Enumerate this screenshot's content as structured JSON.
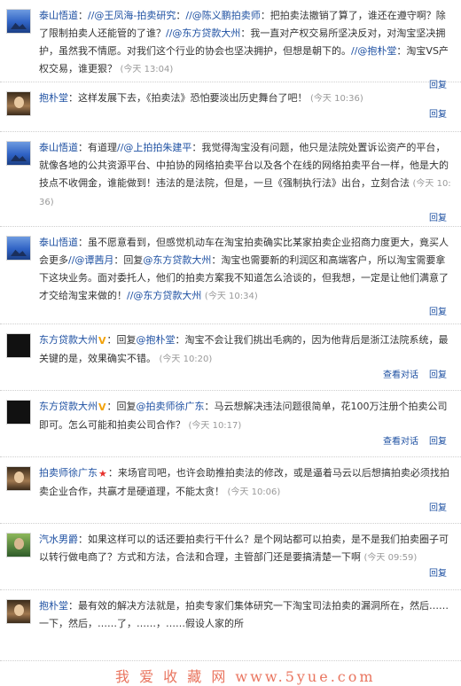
{
  "posts": [
    {
      "avatar": "mountain-sky-avatar",
      "author": "泰山悟道",
      "segments": [
        {
          "t": "text",
          "v": "："
        },
        {
          "t": "link",
          "v": "//@王凤海-拍卖研究"
        },
        {
          "t": "text",
          "v": "："
        },
        {
          "t": "link",
          "v": "//@陈义鹏拍卖师"
        },
        {
          "t": "text",
          "v": "：把拍卖法撤销了算了，谁还在遵守啊？除了限制拍卖人还能管的了谁？"
        },
        {
          "t": "link",
          "v": "//@东方贷款大州"
        },
        {
          "t": "text",
          "v": "：我一直对产权交易所坚决反对，对淘宝坚决拥护，虽然我不情愿。对我们这个行业的协会也坚决拥护，但想是朝下的。"
        },
        {
          "t": "link",
          "v": "//@抱朴堂"
        },
        {
          "t": "text",
          "v": "：淘宝VS产权交易，谁更狠？"
        }
      ],
      "time": "(今天 13:04)",
      "actions": [
        "回复"
      ]
    },
    {
      "avatar": "person-avatar",
      "author": "抱朴堂",
      "segments": [
        {
          "t": "text",
          "v": "：这样发展下去，《拍卖法》恐怕要淡出历史舞台了吧！"
        }
      ],
      "time": "(今天 10:36)",
      "actions": [
        "回复"
      ]
    },
    {
      "avatar": "mountain-sky-avatar",
      "author": "泰山悟道",
      "segments": [
        {
          "t": "text",
          "v": "：有道理"
        },
        {
          "t": "link",
          "v": "//@上拍拍朱建平"
        },
        {
          "t": "text",
          "v": "：我觉得淘宝没有问题，他只是法院处置诉讼资产的平台，就像各地的公共资源平台、中拍协的网络拍卖平台以及各个在线的网络拍卖平台一样，他是大的技点不收佣金，谁能做到！违法的是法院，但是，一旦《强制执行法》出台，立刻合法"
        }
      ],
      "time": "(今天 10:36)",
      "actions": [
        "回复"
      ]
    },
    {
      "avatar": "mountain-sky-avatar",
      "author": "泰山悟道",
      "segments": [
        {
          "t": "text",
          "v": "：虽不愿意看到，但感觉机动车在淘宝拍卖确实比某家拍卖企业招商力度更大，竟买人会更多"
        },
        {
          "t": "link",
          "v": "//@谭茜月"
        },
        {
          "t": "text",
          "v": "：回复"
        },
        {
          "t": "link",
          "v": "@东方贷款大州"
        },
        {
          "t": "text",
          "v": "：淘宝也需要新的利润区和高端客户，所以淘宝需要拿下这块业务。面对委托人，他们的拍卖方案我不知道怎么洽谈的，但我想，一定是让他们满意了才交给淘宝来做的！"
        },
        {
          "t": "link",
          "v": "//@东方贷款大州"
        }
      ],
      "time": "(今天 10:34)",
      "actions": [
        "回复"
      ]
    },
    {
      "avatar": "dark-avatar",
      "author": "东方贷款大州",
      "badge": "V",
      "segments": [
        {
          "t": "text",
          "v": "：回复"
        },
        {
          "t": "link",
          "v": "@抱朴堂"
        },
        {
          "t": "text",
          "v": "：淘宝不会让我们挑出毛病的，因为他背后是浙江法院系统，最关键的是，效果确实不错。"
        }
      ],
      "time": "(今天 10:20)",
      "actions": [
        "查看对话",
        "回复"
      ]
    },
    {
      "avatar": "dark-avatar",
      "author": "东方贷款大州",
      "badge": "V",
      "segments": [
        {
          "t": "text",
          "v": "：回复"
        },
        {
          "t": "link",
          "v": "@拍卖师徐广东"
        },
        {
          "t": "text",
          "v": "：马云想解决违法问题很简单，花100万注册个拍卖公司即可。怎么可能和拍卖公司合作？"
        }
      ],
      "time": "(今天 10:17)",
      "actions": [
        "查看对话",
        "回复"
      ]
    },
    {
      "avatar": "person-avatar",
      "author": "拍卖师徐广东",
      "badge": "star",
      "segments": [
        {
          "t": "text",
          "v": "：来场官司吧，也许会助推拍卖法的修改，或是逼着马云以后想搞拍卖必须找拍卖企业合作，共赢才是硬道理，不能太贪！"
        }
      ],
      "time": "(今天 10:06)",
      "actions": [
        "回复"
      ]
    },
    {
      "avatar": "green-avatar",
      "author": "汽水男爵",
      "segments": [
        {
          "t": "text",
          "v": "：如果这样可以的话还要拍卖行干什么？是个网站都可以拍卖，是不是我们拍卖圈子可以转行做电商了？方式和方法，合法和合理，主管部门还是要搞清楚一下啊"
        }
      ],
      "time": "(今天 09:59)",
      "actions": [
        "回复"
      ]
    },
    {
      "avatar": "person-avatar",
      "author": "抱朴堂",
      "segments": [
        {
          "t": "text",
          "v": "：最有效的解决方法就是，拍卖专家们集体研究一下淘宝司法拍卖的漏洞所在，然后……一下，然后，……了，……，……假设人家的所"
        }
      ],
      "time": "",
      "actions": []
    }
  ],
  "watermark": "我 爱 收 藏 网 www.5yue.com"
}
